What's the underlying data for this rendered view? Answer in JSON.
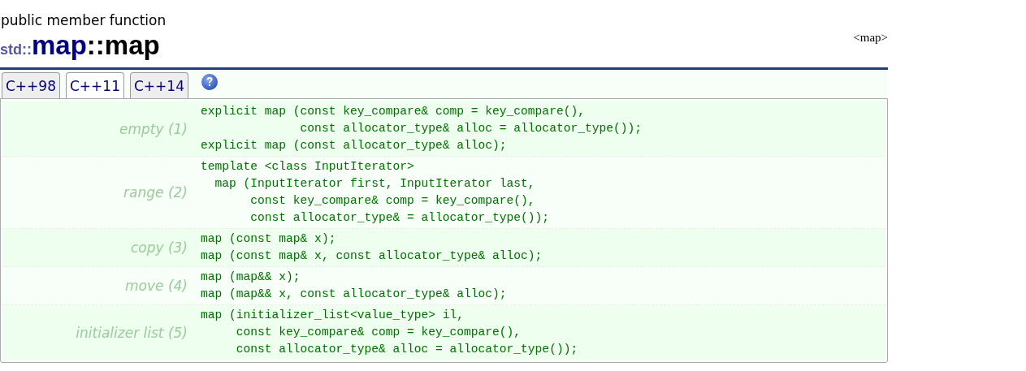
{
  "kind_label": "public member function",
  "title": {
    "namespace": "std::",
    "class": "map",
    "member": "::map"
  },
  "header_link": "<map>",
  "tabs": [
    {
      "label": "C++98",
      "selected": false
    },
    {
      "label": "C++11",
      "selected": true
    },
    {
      "label": "C++14",
      "selected": false
    }
  ],
  "help_icon": true,
  "overloads": [
    {
      "label": "empty (1)",
      "lines": [
        "explicit map (const key_compare& comp = key_compare(),",
        "              const allocator_type& alloc = allocator_type());",
        "explicit map (const allocator_type& alloc);"
      ]
    },
    {
      "label": "range (2)",
      "lines": [
        "template <class InputIterator>",
        "  map (InputIterator first, InputIterator last,",
        "       const key_compare& comp = key_compare(),",
        "       const allocator_type& = allocator_type());"
      ]
    },
    {
      "label": "copy (3)",
      "lines": [
        "map (const map& x);",
        "map (const map& x, const allocator_type& alloc);"
      ]
    },
    {
      "label": "move (4)",
      "lines": [
        "map (map&& x);",
        "map (map&& x, const allocator_type& alloc);"
      ]
    },
    {
      "label": "initializer list (5)",
      "lines": [
        "map (initializer_list<value_type> il,",
        "     const key_compare& comp = key_compare(),",
        "     const allocator_type& alloc = allocator_type());"
      ]
    }
  ]
}
